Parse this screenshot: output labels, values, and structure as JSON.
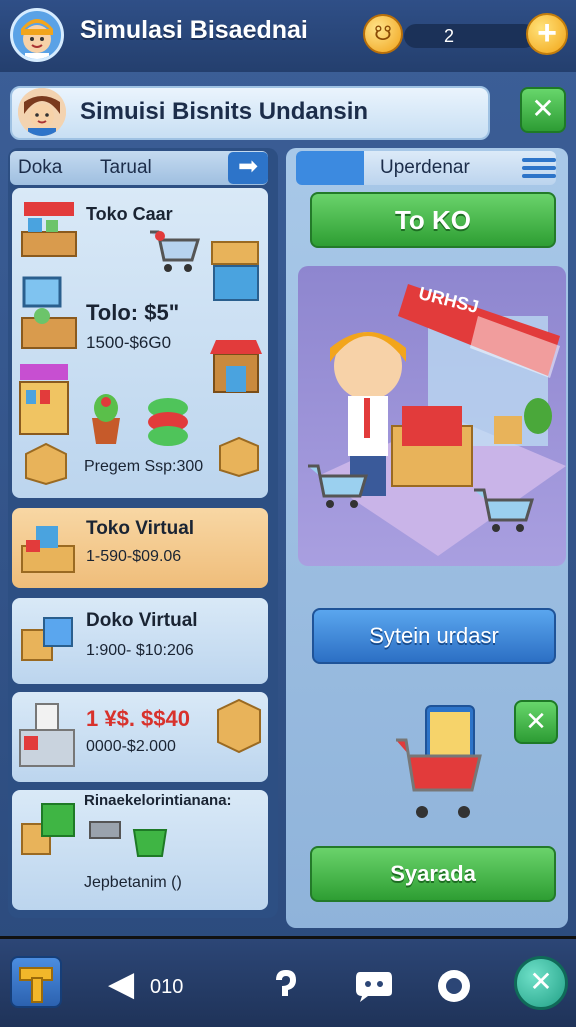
{
  "topbar": {
    "title": "Simulasi Bisaednai",
    "coin_glyph": "☋",
    "coin_count": "2",
    "add_label": "+"
  },
  "header": {
    "title": "Simuisi Bisnits Undansin",
    "close_label": "✕"
  },
  "left_panel": {
    "tabs": [
      "Doka",
      "Tarual"
    ],
    "arrow_label": "➡",
    "items": [
      {
        "title": "Toko Caar",
        "subtitle": ""
      },
      {
        "title": "Tolo: $5\"",
        "subtitle": "1500-$6G0"
      },
      {
        "title": "",
        "subtitle": "Pregem Ssp:300"
      },
      {
        "title": "Toko Virtual",
        "subtitle": "1-590-$09.06"
      },
      {
        "title": "Doko Virtual",
        "subtitle": "1:900- $10:206"
      },
      {
        "title": "1 ¥$. $$40",
        "subtitle": "0000-$2.000"
      },
      {
        "title": "Rinaekelorintianana:",
        "subtitle": "Jepbetanim ()"
      }
    ]
  },
  "right_panel": {
    "header_label": "Uperdenar",
    "toko_button": "To KO",
    "scene_sign": "URHSJ",
    "system_button": "Sytein urdasr",
    "close_label": "✕",
    "bottom_button": "Syarada"
  },
  "bottombar": {
    "back_label": "◀",
    "counter": "010"
  },
  "colors": {
    "green": "#3fb544",
    "blue": "#2d74c9",
    "orange": "#f0a21a",
    "panel": "#2d4f83"
  }
}
